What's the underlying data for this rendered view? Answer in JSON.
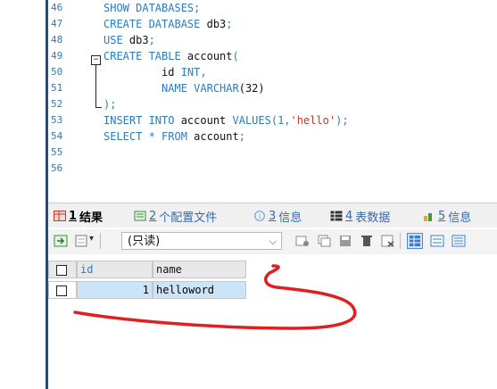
{
  "editor": {
    "lines": [
      {
        "num": "46",
        "parts": [
          {
            "t": "SHOW DATABASES;",
            "c": "kw"
          }
        ]
      },
      {
        "num": "47",
        "parts": [
          {
            "t": "CREATE DATABASE ",
            "c": "kw"
          },
          {
            "t": "db3",
            "c": "ident"
          },
          {
            "t": ";",
            "c": "kw"
          }
        ]
      },
      {
        "num": "48",
        "parts": [
          {
            "t": "USE ",
            "c": "kw"
          },
          {
            "t": "db3",
            "c": "ident"
          },
          {
            "t": ";",
            "c": "kw"
          }
        ]
      },
      {
        "num": "49",
        "parts": [
          {
            "t": "CREATE TABLE ",
            "c": "kw"
          },
          {
            "t": "account",
            "c": "ident"
          },
          {
            "t": "(",
            "c": "kw"
          }
        ]
      },
      {
        "num": "50",
        "parts": [
          {
            "t": "         ",
            "c": "ident"
          },
          {
            "t": "id",
            "c": "ident"
          },
          {
            "t": " INT,",
            "c": "kw"
          }
        ]
      },
      {
        "num": "51",
        "parts": [
          {
            "t": "         NAME VARCHAR",
            "c": "kw"
          },
          {
            "t": "(32)",
            "c": "ident"
          }
        ]
      },
      {
        "num": "52",
        "parts": [
          {
            "t": ");",
            "c": "kw"
          }
        ]
      },
      {
        "num": "53",
        "parts": [
          {
            "t": "INSERT INTO ",
            "c": "kw"
          },
          {
            "t": "account",
            "c": "ident"
          },
          {
            "t": " VALUES(1,",
            "c": "kw"
          },
          {
            "t": "'hello'",
            "c": "str"
          },
          {
            "t": ");",
            "c": "kw"
          }
        ]
      },
      {
        "num": "54",
        "parts": [
          {
            "t": "SELECT * FROM ",
            "c": "kw"
          },
          {
            "t": "account",
            "c": "ident"
          },
          {
            "t": ";",
            "c": "kw"
          }
        ]
      },
      {
        "num": "55",
        "parts": []
      },
      {
        "num": "56",
        "parts": []
      }
    ]
  },
  "tabs": [
    {
      "num": "1",
      "label": "结果",
      "icon": "result-grid-icon",
      "active": true
    },
    {
      "num": "2",
      "label": "个配置文件",
      "icon": "profile-icon",
      "active": false
    },
    {
      "num": "3",
      "label": "信息",
      "icon": "info-icon",
      "active": false
    },
    {
      "num": "4",
      "label": "表数据",
      "icon": "table-data-icon",
      "active": false
    },
    {
      "num": "5",
      "label": "信息",
      "icon": "history-info-icon",
      "active": false
    }
  ],
  "toolbar": {
    "readonly_label": "(只读)",
    "icons": [
      "export-icon",
      "import-icon",
      "add-row-icon",
      "duplicate-row-icon",
      "save-icon",
      "delete-icon",
      "refresh-icon",
      "grid-view-icon",
      "form-view-icon",
      "text-view-icon"
    ]
  },
  "grid": {
    "columns": [
      "id",
      "name"
    ],
    "rows": [
      {
        "id": "1",
        "name": "helloword"
      }
    ]
  },
  "colors": {
    "keyword": "#2b7bc0",
    "string": "#c0392b",
    "annotation": "#e02020",
    "selected_cell": "#cce4f7"
  }
}
